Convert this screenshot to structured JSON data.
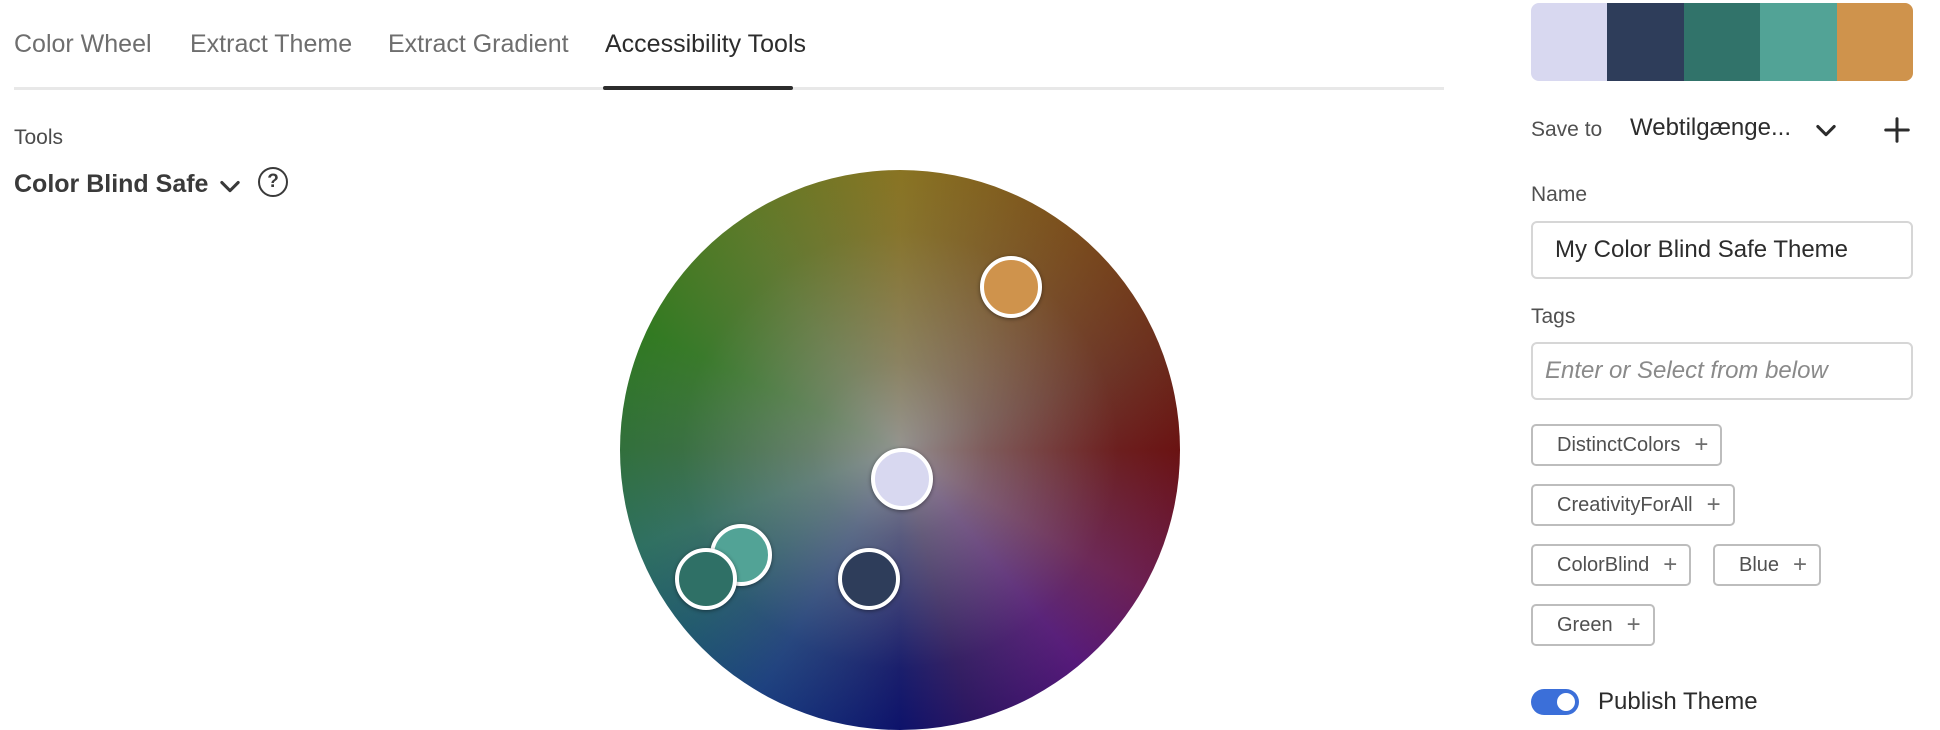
{
  "tabs": [
    {
      "label": "Color Wheel",
      "active": false
    },
    {
      "label": "Extract Theme",
      "active": false
    },
    {
      "label": "Extract Gradient",
      "active": false
    },
    {
      "label": "Accessibility Tools",
      "active": true
    }
  ],
  "tools": {
    "label": "Tools",
    "mode": "Color Blind Safe",
    "help_icon": "question-circle-icon",
    "help_glyph": "?"
  },
  "wheel": {
    "handles": [
      {
        "name": "orange",
        "color": "#cf934c"
      },
      {
        "name": "lavender",
        "color": "#d8d8f0"
      },
      {
        "name": "teal-light",
        "color": "#52a396"
      },
      {
        "name": "teal-dark",
        "color": "#2f7066"
      },
      {
        "name": "navy",
        "color": "#2e3d5a"
      }
    ]
  },
  "swatches": [
    "#d8d8f0",
    "#2e3d5a",
    "#31736a",
    "#52a396",
    "#cf934c"
  ],
  "save": {
    "label": "Save to",
    "value": "Webtilgænge...",
    "dropdown_icon": "chevron-down-icon",
    "add_icon": "plus-icon"
  },
  "name": {
    "label": "Name",
    "value": "My Color Blind Safe Theme"
  },
  "tags": {
    "label": "Tags",
    "placeholder": "Enter or Select from below",
    "suggestions": [
      "DistinctColors",
      "CreativityForAll",
      "ColorBlind",
      "Blue",
      "Green"
    ],
    "add_glyph": "+"
  },
  "publish": {
    "label": "Publish Theme",
    "enabled": true
  },
  "colors": {
    "accent": "#3b6fd9",
    "text": "#2c2c2c"
  }
}
